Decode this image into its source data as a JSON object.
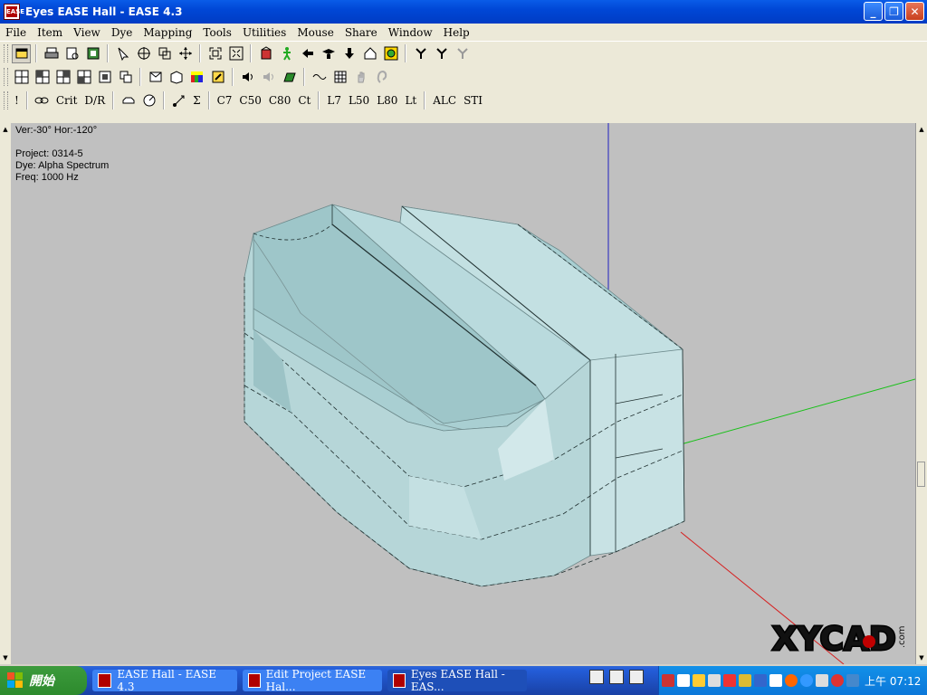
{
  "window": {
    "title": "Eyes EASE Hall - EASE 4.3",
    "app_icon_text": "EASE",
    "minimize_glyph": "_",
    "restore_glyph": "❐",
    "close_glyph": "✕"
  },
  "menu": [
    "File",
    "Item",
    "View",
    "Dye",
    "Mapping",
    "Tools",
    "Utilities",
    "Mouse",
    "Share",
    "Window",
    "Help"
  ],
  "toolbar3_labels": {
    "excl": "!",
    "crit": "Crit",
    "dr": "D/R",
    "sigma": "Σ",
    "c7": "C7",
    "c50": "C50",
    "c80": "C80",
    "ct": "Ct",
    "l7": "L7",
    "l50": "L50",
    "l80": "L80",
    "lt": "Lt",
    "alc": "ALC",
    "sti": "STI"
  },
  "viewport": {
    "angles": "Ver:-30°   Hor:-120°",
    "project": "Project: 0314-5",
    "dye": "Dye: Alpha Spectrum",
    "freq": "Freq: 1000 Hz",
    "watermark": "XYCAD",
    "watermark_sub": ".com"
  },
  "taskbar": {
    "start_label": "開始",
    "tasks": [
      {
        "label": "EASE Hall - EASE 4.3",
        "active": false
      },
      {
        "label": "Edit Project EASE Hal...",
        "active": false
      },
      {
        "label": "Eyes EASE Hall - EAS...",
        "active": true
      }
    ],
    "clock": "上午 07:12"
  },
  "colors": {
    "model_face": "#b6d6d8",
    "axis_x": "#d62020",
    "axis_y": "#18c018",
    "axis_z": "#2020c0",
    "viewport_bg": "#c0c0c0"
  }
}
